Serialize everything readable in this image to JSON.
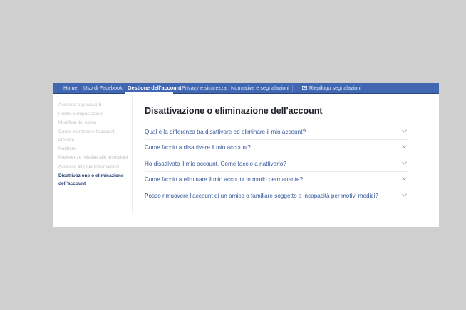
{
  "nav": {
    "items": [
      {
        "label": "Home"
      },
      {
        "label": "Uso di Facebook"
      },
      {
        "label": "Gestione dell'account"
      },
      {
        "label": "Privacy e sicurezza"
      },
      {
        "label": "Normative e segnalazioni"
      }
    ],
    "active_item": "Gestione dell'account",
    "report_summary": {
      "label": "Riepilogo segnalazioni",
      "icon": "envelope-icon"
    }
  },
  "sidebar": {
    "items": [
      {
        "label": "Accesso e password"
      },
      {
        "label": "Profilo e impostazioni"
      },
      {
        "label": "Modifica del nome"
      },
      {
        "label": "Come mantenere l'account protetto"
      },
      {
        "label": "Notifiche"
      },
      {
        "label": "Preferenze relative alle inserzioni"
      },
      {
        "label": "Accesso alle tue informazioni"
      },
      {
        "label": "Disattivazione o eliminazione dell'account"
      }
    ],
    "active_item": "Disattivazione o eliminazione dell'account"
  },
  "main": {
    "title": "Disattivazione o eliminazione dell'account",
    "questions": [
      {
        "text": "Qual è la differenza tra disattivare ed eliminare il mio account?",
        "icon": "chevron-down-icon"
      },
      {
        "text": "Come faccio a disattivare il mio account?",
        "icon": "chevron-down-icon"
      },
      {
        "text": "Ho disattivato il mio account. Come faccio a riattivarlo?",
        "icon": "chevron-down-icon"
      },
      {
        "text": "Come faccio a eliminare il mio account in modo permanente?",
        "icon": "chevron-down-icon"
      },
      {
        "text": "Posso rimuovere l'account di un amico o familiare soggetto a incapacità per motivi medici?",
        "icon": "chevron-down-icon"
      }
    ]
  },
  "colors": {
    "nav_bar": "#4267b2",
    "link": "#365899",
    "sidebar_inactive": "#bec3c9",
    "page_background": "#cfcfcf"
  }
}
